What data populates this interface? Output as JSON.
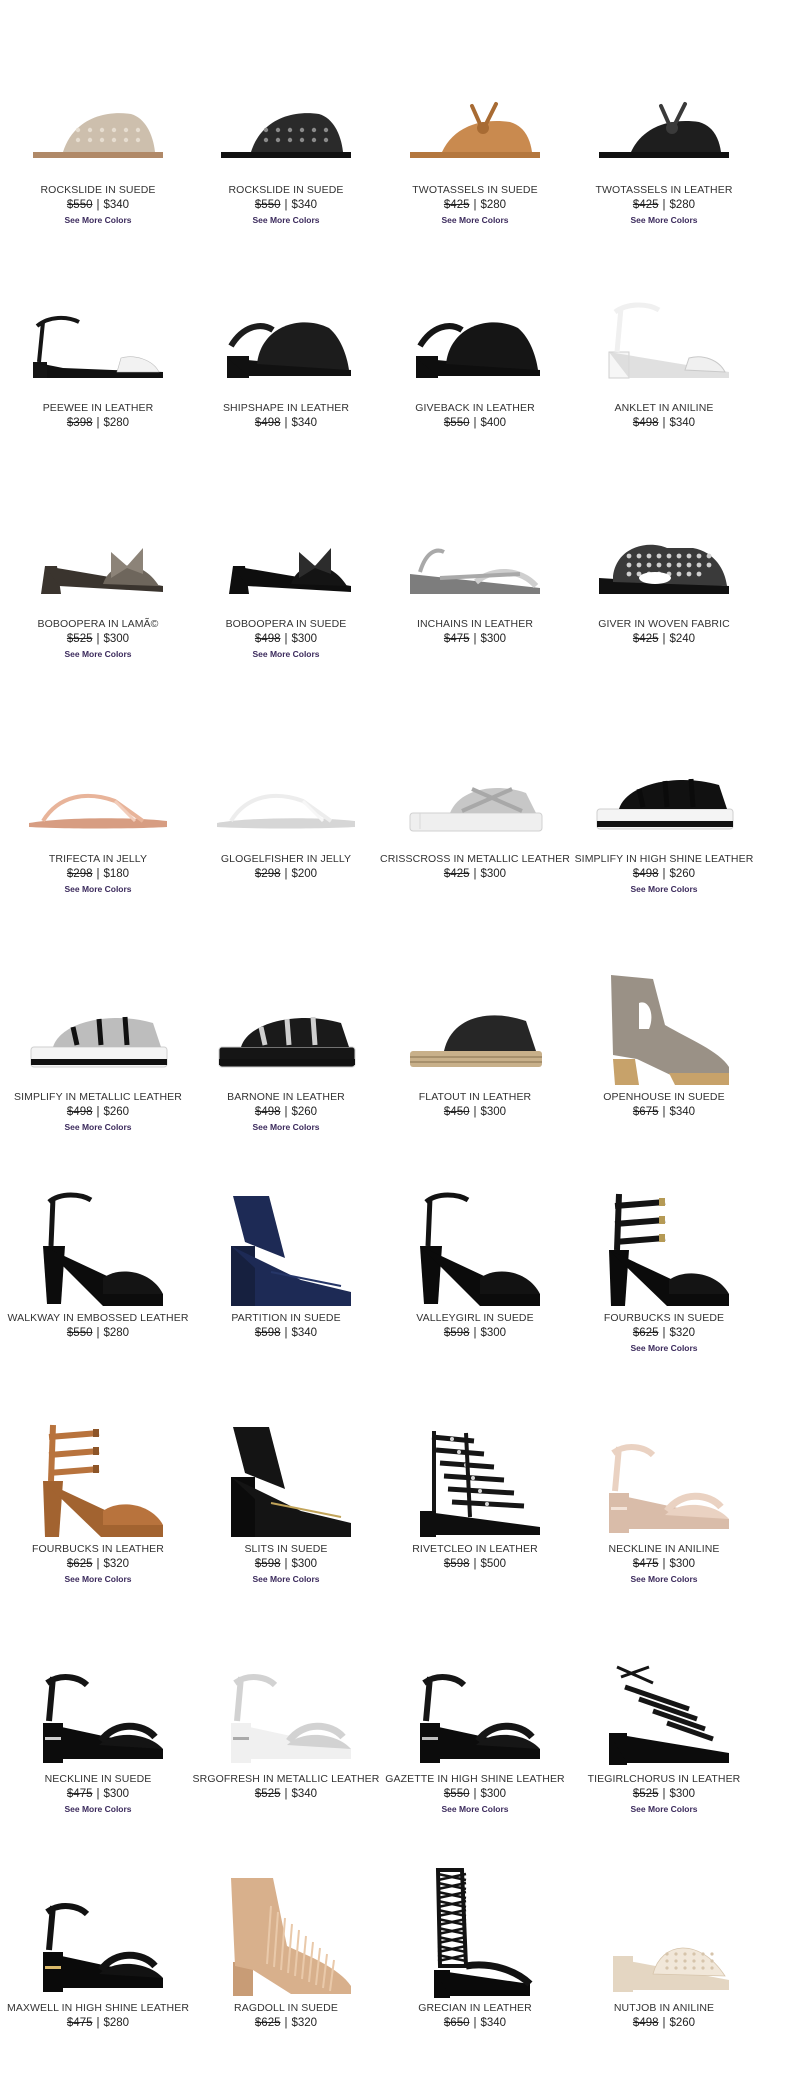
{
  "more_colors_label": "See More Colors",
  "price_separator": "|",
  "products": [
    {
      "name": "ROCKSLIDE IN SUEDE",
      "old_price": "$550",
      "price": "$340",
      "more_colors": true,
      "style": "slide",
      "colors": {
        "main": "#cdbfad",
        "sole": "#b08968",
        "accent": "#e6ddd0"
      }
    },
    {
      "name": "ROCKSLIDE IN SUEDE",
      "old_price": "$550",
      "price": "$340",
      "more_colors": true,
      "style": "slide",
      "colors": {
        "main": "#2a2a2a",
        "sole": "#111111",
        "accent": "#8a8a8a"
      }
    },
    {
      "name": "TWOTASSELS IN SUEDE",
      "old_price": "$425",
      "price": "$280",
      "more_colors": true,
      "style": "tassel",
      "colors": {
        "main": "#c98a4f",
        "sole": "#b4773e",
        "accent": "#a86b33"
      }
    },
    {
      "name": "TWOTASSELS IN LEATHER",
      "old_price": "$425",
      "price": "$280",
      "more_colors": true,
      "style": "tassel",
      "colors": {
        "main": "#1e1e1e",
        "sole": "#111111",
        "accent": "#3a3a3a"
      }
    },
    {
      "name": "PEEWEE IN LEATHER",
      "old_price": "$398",
      "price": "$280",
      "more_colors": false,
      "style": "strap-low",
      "colors": {
        "main": "#151515",
        "sole": "#111111",
        "accent": "#f2f2f2"
      }
    },
    {
      "name": "SHIPSHAPE IN LEATHER",
      "old_price": "$498",
      "price": "$340",
      "more_colors": false,
      "style": "mule-block",
      "colors": {
        "main": "#1c1c1c",
        "sole": "#111111",
        "accent": "#3a3a3a"
      }
    },
    {
      "name": "GIVEBACK IN LEATHER",
      "old_price": "$550",
      "price": "$400",
      "more_colors": false,
      "style": "mule-block",
      "colors": {
        "main": "#151515",
        "sole": "#0e0e0e",
        "accent": "#333333"
      }
    },
    {
      "name": "ANKLET IN ANILINE",
      "old_price": "$498",
      "price": "$340",
      "more_colors": false,
      "style": "strap-clear",
      "colors": {
        "main": "#f0f0f0",
        "sole": "#d8d8d8",
        "accent": "#c9c9c9"
      }
    },
    {
      "name": "BOBOOPERA IN LAMÃ©",
      "old_price": "$525",
      "price": "$300",
      "more_colors": true,
      "style": "bow-mule",
      "colors": {
        "main": "#6e665c",
        "sole": "#3a342e",
        "accent": "#8c8378"
      }
    },
    {
      "name": "BOBOOPERA IN SUEDE",
      "old_price": "$498",
      "price": "$300",
      "more_colors": true,
      "style": "bow-mule",
      "colors": {
        "main": "#141414",
        "sole": "#0e0e0e",
        "accent": "#2c2c2c"
      }
    },
    {
      "name": "INCHAINS IN LEATHER",
      "old_price": "$475",
      "price": "$300",
      "more_colors": false,
      "style": "wedge-low",
      "colors": {
        "main": "#a9a9a9",
        "sole": "#7d7d7d",
        "accent": "#cfcfcf"
      }
    },
    {
      "name": "GIVER IN WOVEN FABRIC",
      "old_price": "$425",
      "price": "$240",
      "more_colors": false,
      "style": "woven-wedge",
      "colors": {
        "main": "#3a3a3a",
        "sole": "#111111",
        "accent": "#cfcfcf"
      }
    },
    {
      "name": "TRIFECTA IN JELLY",
      "old_price": "$298",
      "price": "$180",
      "more_colors": true,
      "style": "thong",
      "colors": {
        "main": "#e8b49a",
        "sole": "#d79d82",
        "accent": "#f2cdbb"
      }
    },
    {
      "name": "GLOGELFISHER IN JELLY",
      "old_price": "$298",
      "price": "$200",
      "more_colors": false,
      "style": "thong",
      "colors": {
        "main": "#ededed",
        "sole": "#d6d6d6",
        "accent": "#f7f7f7"
      }
    },
    {
      "name": "CRISSCROSS IN METALLIC LEATHER",
      "old_price": "$425",
      "price": "$300",
      "more_colors": false,
      "style": "platform-slide",
      "colors": {
        "main": "#c7c7c7",
        "sole": "#efefef",
        "accent": "#a8a8a8"
      }
    },
    {
      "name": "SIMPLIFY IN HIGH SHINE LEATHER",
      "old_price": "$498",
      "price": "$260",
      "more_colors": true,
      "style": "flatform",
      "colors": {
        "main": "#111111",
        "sole": "#f4f4f4",
        "accent": "#0b0b0b"
      }
    },
    {
      "name": "SIMPLIFY IN METALLIC LEATHER",
      "old_price": "$498",
      "price": "$260",
      "more_colors": true,
      "style": "flatform",
      "colors": {
        "main": "#bdbdbd",
        "sole": "#f4f4f4",
        "accent": "#111111"
      }
    },
    {
      "name": "BARNONE IN LEATHER",
      "old_price": "$498",
      "price": "$260",
      "more_colors": true,
      "style": "flatform",
      "colors": {
        "main": "#1a1a1a",
        "sole": "#151515",
        "accent": "#cfcfcf"
      }
    },
    {
      "name": "FLATOUT IN LEATHER",
      "old_price": "$450",
      "price": "$300",
      "more_colors": false,
      "style": "espadrille",
      "colors": {
        "main": "#262626",
        "sole": "#c8b08a",
        "accent": "#9c8563"
      }
    },
    {
      "name": "OPENHOUSE IN SUEDE",
      "old_price": "$675",
      "price": "$340",
      "more_colors": false,
      "style": "bootie",
      "colors": {
        "main": "#9a9186",
        "sole": "#c7a26a",
        "accent": "#7d756b"
      }
    },
    {
      "name": "WALKWAY IN EMBOSSED LEATHER",
      "old_price": "$550",
      "price": "$280",
      "more_colors": false,
      "style": "heel-platform",
      "colors": {
        "main": "#141414",
        "sole": "#0c0c0c",
        "accent": "#2a2a2a"
      }
    },
    {
      "name": "PARTITION IN SUEDE",
      "old_price": "$598",
      "price": "$340",
      "more_colors": false,
      "style": "heel-block",
      "colors": {
        "main": "#1d2a55",
        "sole": "#16203f",
        "accent": "#263668"
      }
    },
    {
      "name": "VALLEYGIRL IN SUEDE",
      "old_price": "$598",
      "price": "$300",
      "more_colors": false,
      "style": "heel-platform",
      "colors": {
        "main": "#121212",
        "sole": "#0b0b0b",
        "accent": "#222222"
      }
    },
    {
      "name": "FOURBUCKS IN SUEDE",
      "old_price": "$625",
      "price": "$320",
      "more_colors": true,
      "style": "heel-straps",
      "colors": {
        "main": "#141414",
        "sole": "#0b0b0b",
        "accent": "#b59a55"
      }
    },
    {
      "name": "FOURBUCKS IN LEATHER",
      "old_price": "$625",
      "price": "$320",
      "more_colors": true,
      "style": "heel-straps",
      "colors": {
        "main": "#b8733d",
        "sole": "#a26330",
        "accent": "#8d5528"
      }
    },
    {
      "name": "SLITS IN SUEDE",
      "old_price": "$598",
      "price": "$300",
      "more_colors": true,
      "style": "heel-block",
      "colors": {
        "main": "#141414",
        "sole": "#0b0b0b",
        "accent": "#c2a45a"
      }
    },
    {
      "name": "RIVETCLEO IN LEATHER",
      "old_price": "$598",
      "price": "$500",
      "more_colors": false,
      "style": "gladiator-low",
      "colors": {
        "main": "#161616",
        "sole": "#0e0e0e",
        "accent": "#d8d8d8"
      }
    },
    {
      "name": "NECKLINE IN ANILINE",
      "old_price": "$475",
      "price": "$300",
      "more_colors": true,
      "style": "heel-mid",
      "colors": {
        "main": "#ead2c2",
        "sole": "#d9bca9",
        "accent": "#f3e3d8"
      }
    },
    {
      "name": "NECKLINE IN SUEDE",
      "old_price": "$475",
      "price": "$300",
      "more_colors": true,
      "style": "heel-mid",
      "colors": {
        "main": "#141414",
        "sole": "#0c0c0c",
        "accent": "#cfcfcf"
      }
    },
    {
      "name": "SRGOFRESH IN METALLIC LEATHER",
      "old_price": "$525",
      "price": "$340",
      "more_colors": false,
      "style": "heel-mid",
      "colors": {
        "main": "#d2d2d2",
        "sole": "#f0f0f0",
        "accent": "#aaaaaa"
      }
    },
    {
      "name": "GAZETTE IN HIGH SHINE LEATHER",
      "old_price": "$550",
      "price": "$300",
      "more_colors": true,
      "style": "heel-mid",
      "colors": {
        "main": "#161616",
        "sole": "#0c0c0c",
        "accent": "#bdbdbd"
      }
    },
    {
      "name": "TIEGIRLCHORUS IN LEATHER",
      "old_price": "$525",
      "price": "$300",
      "more_colors": true,
      "style": "lace-up",
      "colors": {
        "main": "#151515",
        "sole": "#0c0c0c",
        "accent": "#2a2a2a"
      }
    },
    {
      "name": "MAXWELL IN HIGH SHINE LEATHER",
      "old_price": "$475",
      "price": "$280",
      "more_colors": false,
      "style": "heel-mid",
      "colors": {
        "main": "#121212",
        "sole": "#0a0a0a",
        "accent": "#d9b96a"
      }
    },
    {
      "name": "RAGDOLL IN SUEDE",
      "old_price": "$625",
      "price": "$320",
      "more_colors": false,
      "style": "fringe-bootie",
      "colors": {
        "main": "#d8b08c",
        "sole": "#c89c76",
        "accent": "#e9c9aa"
      }
    },
    {
      "name": "GRECIAN IN LEATHER",
      "old_price": "$650",
      "price": "$340",
      "more_colors": false,
      "style": "lace-boot",
      "colors": {
        "main": "#121212",
        "sole": "#0a0a0a",
        "accent": "#2a2a2a"
      }
    },
    {
      "name": "NUTJOB IN ANILINE",
      "old_price": "$498",
      "price": "$260",
      "more_colors": false,
      "style": "mule-perforated",
      "colors": {
        "main": "#f1e7d9",
        "sole": "#e4d6c2",
        "accent": "#d6c4ab"
      }
    }
  ]
}
